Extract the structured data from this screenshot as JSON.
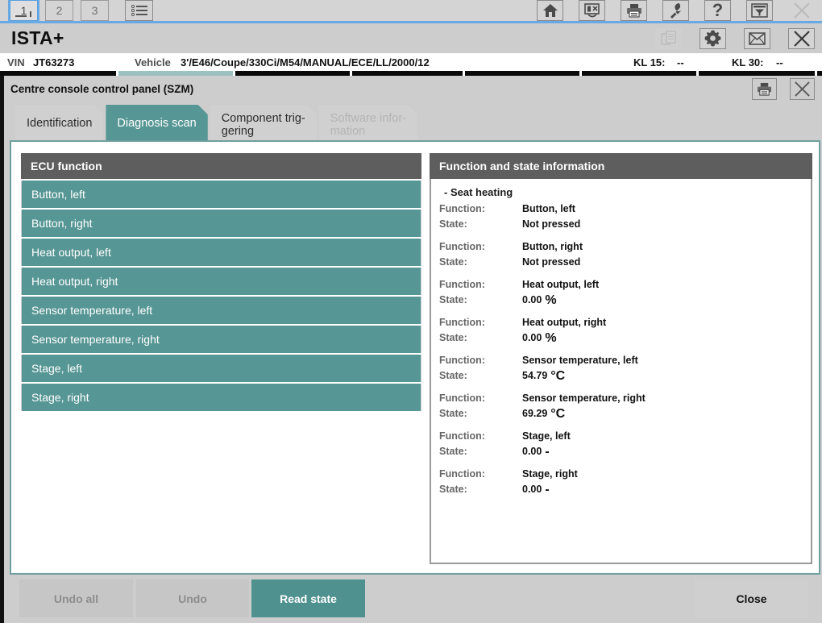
{
  "topbar": {
    "tabs": [
      {
        "label": "1",
        "selected": true,
        "icon": "numbered-tab-1-icon"
      },
      {
        "label": "2",
        "selected": false,
        "icon": "numbered-tab-2-icon"
      },
      {
        "label": "3",
        "selected": false,
        "icon": "numbered-tab-3-icon"
      }
    ],
    "list_icon": "list-view-icon",
    "actions": [
      {
        "name": "home-icon",
        "label": "Home"
      },
      {
        "name": "close-vehicle-icon",
        "label": "Close vehicle"
      },
      {
        "name": "print-icon",
        "label": "Print"
      },
      {
        "name": "wrench-icon",
        "label": "Service"
      },
      {
        "name": "help-icon",
        "label": "Help"
      },
      {
        "name": "filter-table-icon",
        "label": "Filter"
      },
      {
        "name": "close-icon",
        "label": "Close"
      }
    ]
  },
  "header": {
    "title": "ISTA+",
    "actions": [
      {
        "name": "copy-document-icon",
        "label": "Copy",
        "disabled": true
      },
      {
        "name": "gear-icon",
        "label": "Settings",
        "disabled": false
      },
      {
        "name": "mail-icon",
        "label": "Messages",
        "disabled": false
      },
      {
        "name": "close-icon",
        "label": "Close",
        "disabled": false
      }
    ]
  },
  "vehicle_bar": {
    "vin_label": "VIN",
    "vin_value": "JT63273",
    "vehicle_label": "Vehicle",
    "vehicle_value": "3'/E46/Coupe/330Ci/M54/MANUAL/ECE/LL/2000/12",
    "kl15_label": "KL 15:",
    "kl15_value": "--",
    "kl30_label": "KL 30:",
    "kl30_value": "--"
  },
  "progress_strip": {
    "fill_start_pct": 14.2,
    "fill_end_pct": 28.4,
    "ticks_pct": [
      14.2,
      28.4,
      42.6,
      56.4,
      70.6,
      84.8,
      99.2
    ]
  },
  "dialog": {
    "title": "Centre console control panel (SZM)",
    "actions": [
      {
        "name": "print-icon",
        "label": "Print"
      },
      {
        "name": "close-icon",
        "label": "Close"
      }
    ],
    "tabs": [
      {
        "label": "Identification",
        "state": "normal"
      },
      {
        "label": "Diagnosis scan",
        "state": "active"
      },
      {
        "line1": "Component trig-",
        "line2": "gering",
        "state": "normal"
      },
      {
        "line1": "Software infor-",
        "line2": "mation",
        "state": "disabled"
      }
    ]
  },
  "ecu_panel": {
    "header": "ECU function",
    "rows": [
      "Button, left",
      "Button, right",
      "Heat output, left",
      "Heat output, right",
      "Sensor temperature, left",
      "Sensor temperature, right",
      "Stage, left",
      "Stage, right"
    ]
  },
  "info_panel": {
    "header": "Function and state information",
    "group": "- Seat heating",
    "function_label": "Function:",
    "state_label": "State:",
    "entries": [
      {
        "function": "Button, left",
        "state": "Not pressed",
        "unit": ""
      },
      {
        "function": "Button, right",
        "state": "Not pressed",
        "unit": ""
      },
      {
        "function": "Heat output, left",
        "state": "0.00",
        "unit": "%"
      },
      {
        "function": "Heat output, right",
        "state": "0.00",
        "unit": "%"
      },
      {
        "function": "Sensor temperature, left",
        "state": "54.79",
        "unit": "°C"
      },
      {
        "function": "Sensor temperature, right",
        "state": "69.29",
        "unit": "°C"
      },
      {
        "function": "Stage, left",
        "state": "0.00",
        "unit": "-"
      },
      {
        "function": "Stage, right",
        "state": "0.00",
        "unit": "-"
      }
    ]
  },
  "footer": {
    "undo_all": "Undo all",
    "undo": "Undo",
    "read_state": "Read state",
    "close": "Close"
  },
  "colors": {
    "teal": "#569694",
    "teal_dark": "#4f918f",
    "panel_header": "#5e5e5e",
    "chrome": "#cdcdcd",
    "accent_blue": "#6aaae4"
  }
}
